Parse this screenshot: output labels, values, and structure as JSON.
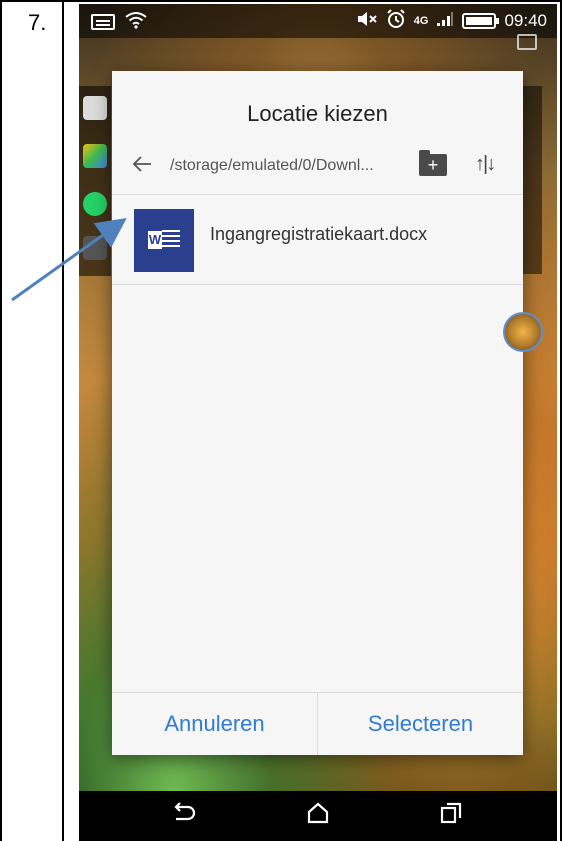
{
  "step": {
    "number": "7."
  },
  "status_bar": {
    "time": "09:40",
    "network": "4G"
  },
  "dialog": {
    "title": "Locatie kiezen",
    "path": "/storage/emulated/0/Downl...",
    "new_folder_symbol": "+",
    "sort_symbol": "↑|↓",
    "files": [
      {
        "name": "Ingangregistratiekaart.docx",
        "icon": "word-document-icon",
        "icon_letter": "W"
      }
    ],
    "cancel_label": "Annuleren",
    "select_label": "Selecteren"
  },
  "colors": {
    "accent": "#2f7bd6",
    "word_icon": "#2b3f8f",
    "dialog_bg": "#f6f6f6",
    "annotation_arrow": "#4f81bd"
  },
  "nav_bar": {
    "back_glyph": "⮌",
    "home_glyph": "⌂",
    "recents_glyph": "❐"
  }
}
